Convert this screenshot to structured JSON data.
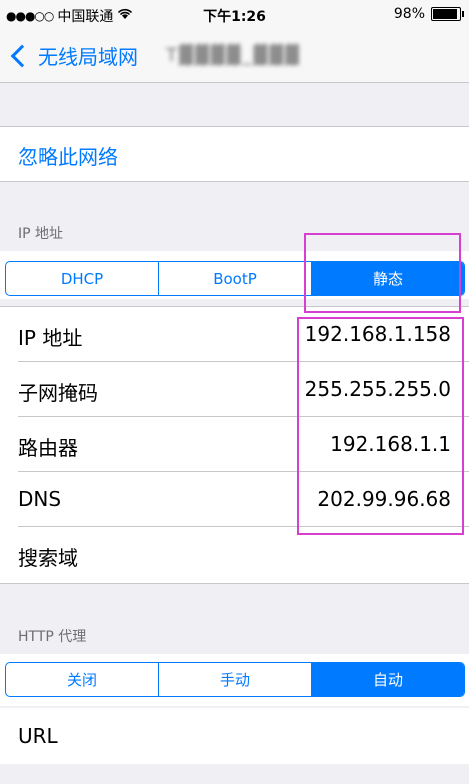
{
  "status": {
    "carrier": "中国联通",
    "time": "下午1:26",
    "battery": "98%",
    "battery_level": 0.98
  },
  "nav": {
    "back_label": "无线局域网",
    "network_name": "T▓▓▓▓_▓▓▓"
  },
  "forget_label": "忽略此网络",
  "ip_section": {
    "header": "IP 地址",
    "segments": [
      "DHCP",
      "BootP",
      "静态"
    ],
    "selected": 2,
    "rows": [
      {
        "label": "IP 地址",
        "value": "192.168.1.158"
      },
      {
        "label": "子网掩码",
        "value": "255.255.255.0"
      },
      {
        "label": "路由器",
        "value": "192.168.1.1"
      },
      {
        "label": "DNS",
        "value": "202.99.96.68"
      },
      {
        "label": "搜索域",
        "value": ""
      }
    ]
  },
  "proxy_section": {
    "header": "HTTP 代理",
    "segments": [
      "关闭",
      "手动",
      "自动"
    ],
    "selected": 2,
    "url_label": "URL"
  },
  "colors": {
    "accent": "#007aff",
    "highlight": "#d63fd0",
    "background": "#efeff4"
  }
}
